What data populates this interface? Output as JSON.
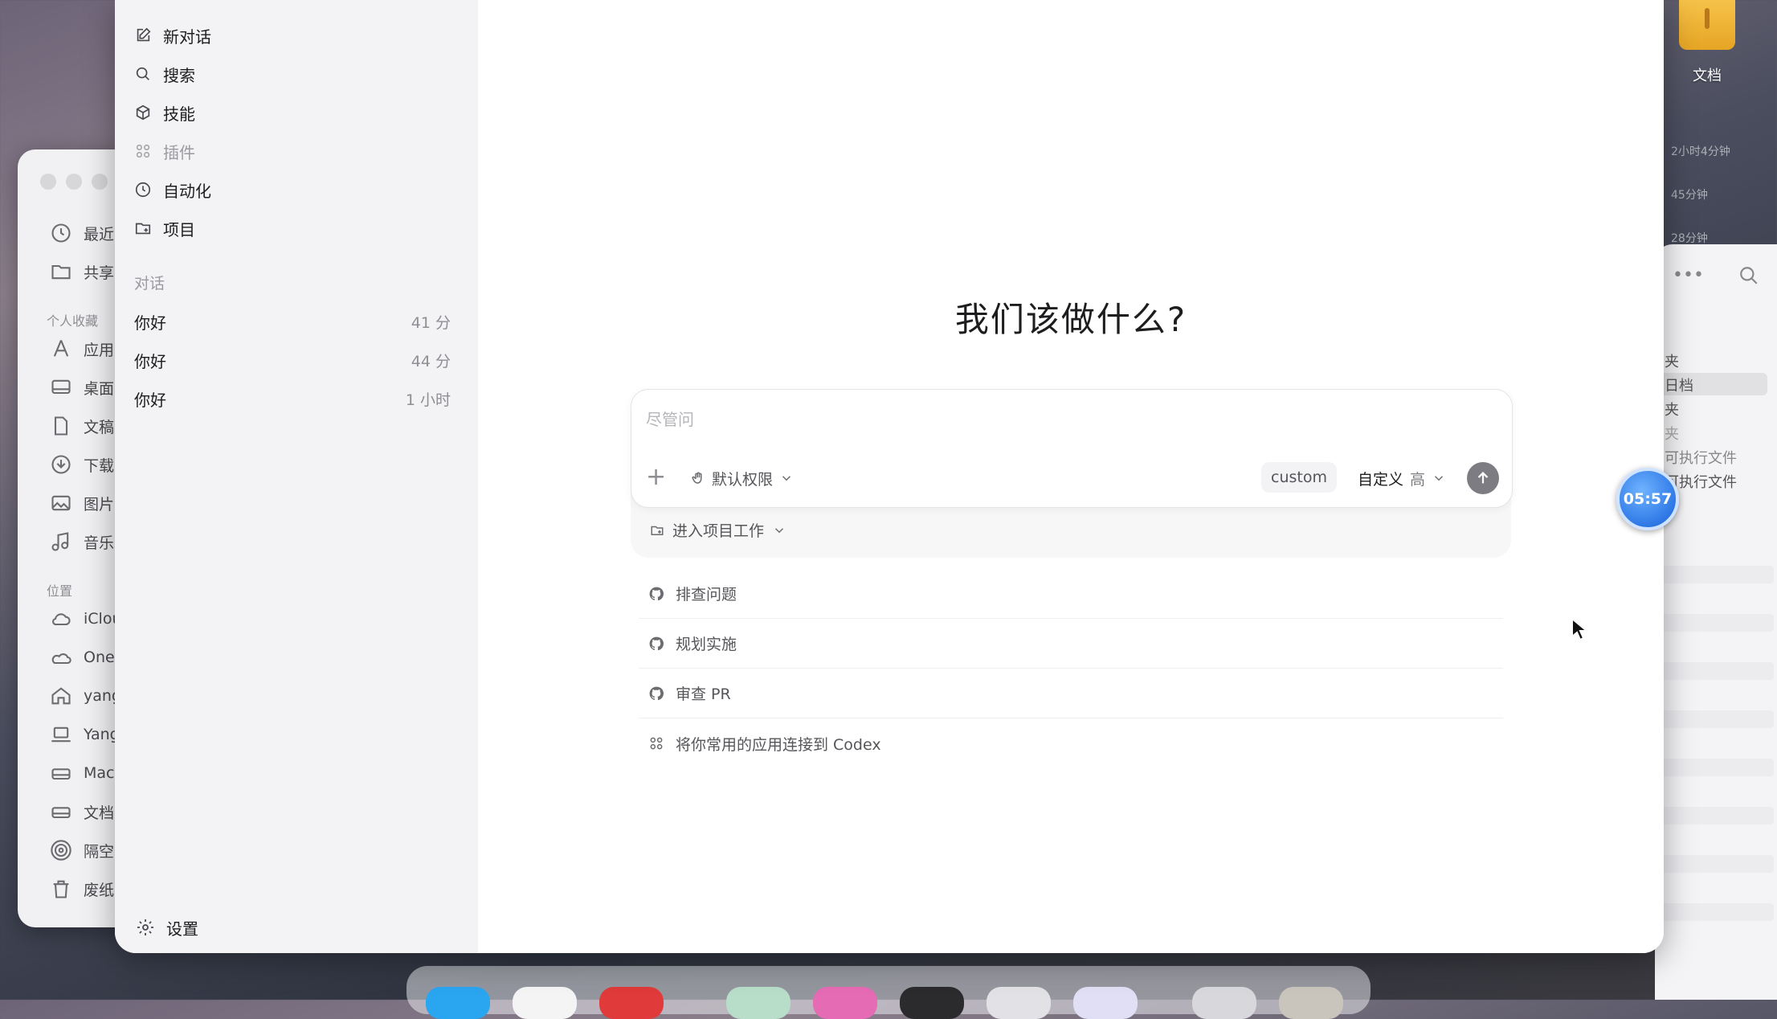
{
  "finder": {
    "items": [
      {
        "label": "最近",
        "icon": "clock-icon"
      },
      {
        "label": "共享",
        "icon": "shared-folder-icon"
      },
      {
        "label": "应用",
        "icon": "app-store-icon"
      },
      {
        "label": "桌面",
        "icon": "desktop-icon"
      },
      {
        "label": "文稿",
        "icon": "document-icon"
      },
      {
        "label": "下载",
        "icon": "download-icon"
      },
      {
        "label": "图片",
        "icon": "photo-icon"
      },
      {
        "label": "音乐",
        "icon": "music-icon"
      },
      {
        "label": "iClou",
        "icon": "cloud-icon"
      },
      {
        "label": "One",
        "icon": "onedrive-icon"
      },
      {
        "label": "yang",
        "icon": "home-icon"
      },
      {
        "label": "Yang",
        "icon": "laptop-icon"
      },
      {
        "label": "Mac",
        "icon": "disk-icon"
      },
      {
        "label": "文档",
        "icon": "disk-icon"
      },
      {
        "label": "隔空",
        "icon": "airdrop-icon"
      },
      {
        "label": "废纸",
        "icon": "trash-icon"
      }
    ],
    "section_favorites": "个人收藏",
    "section_locations": "位置"
  },
  "desktop": {
    "file_label": "文档",
    "times": [
      "2小时4分钟",
      "45分钟",
      "28分钟"
    ]
  },
  "right_window": {
    "rows": [
      "夹",
      "日档",
      "夹",
      "夹",
      "可执行文件",
      "可执行文件"
    ]
  },
  "timer": "05:57",
  "sidebar": {
    "nav": [
      {
        "label": "新对话",
        "icon": "new-chat-icon"
      },
      {
        "label": "搜索",
        "icon": "search-icon"
      },
      {
        "label": "技能",
        "icon": "skills-icon"
      },
      {
        "label": "插件",
        "icon": "plugins-icon"
      },
      {
        "label": "自动化",
        "icon": "automation-icon"
      },
      {
        "label": "项目",
        "icon": "project-icon"
      }
    ],
    "section_label": "对话",
    "conversations": [
      {
        "title": "你好",
        "time": "41 分"
      },
      {
        "title": "你好",
        "time": "44 分"
      },
      {
        "title": "你好",
        "time": "1 小时"
      }
    ],
    "settings_label": "设置"
  },
  "main": {
    "headline": "我们该做什么?",
    "composer": {
      "placeholder": "尽管问",
      "permission_label": "默认权限",
      "model_label": "custom",
      "effort_label": "自定义",
      "effort_level": "高"
    },
    "project_label": "进入项目工作",
    "suggestions": [
      {
        "label": "排查问题",
        "icon": "github-icon"
      },
      {
        "label": "规划实施",
        "icon": "github-icon"
      },
      {
        "label": "审查 PR",
        "icon": "github-icon"
      },
      {
        "label": "将你常用的应用连接到 Codex",
        "icon": "apps-grid-icon"
      }
    ]
  },
  "colors": {
    "sidebar_bg": "#f3f2f5",
    "main_bg": "#ffffff",
    "send_button": "#7c7c82",
    "timer_blue": "#2f79e6"
  }
}
